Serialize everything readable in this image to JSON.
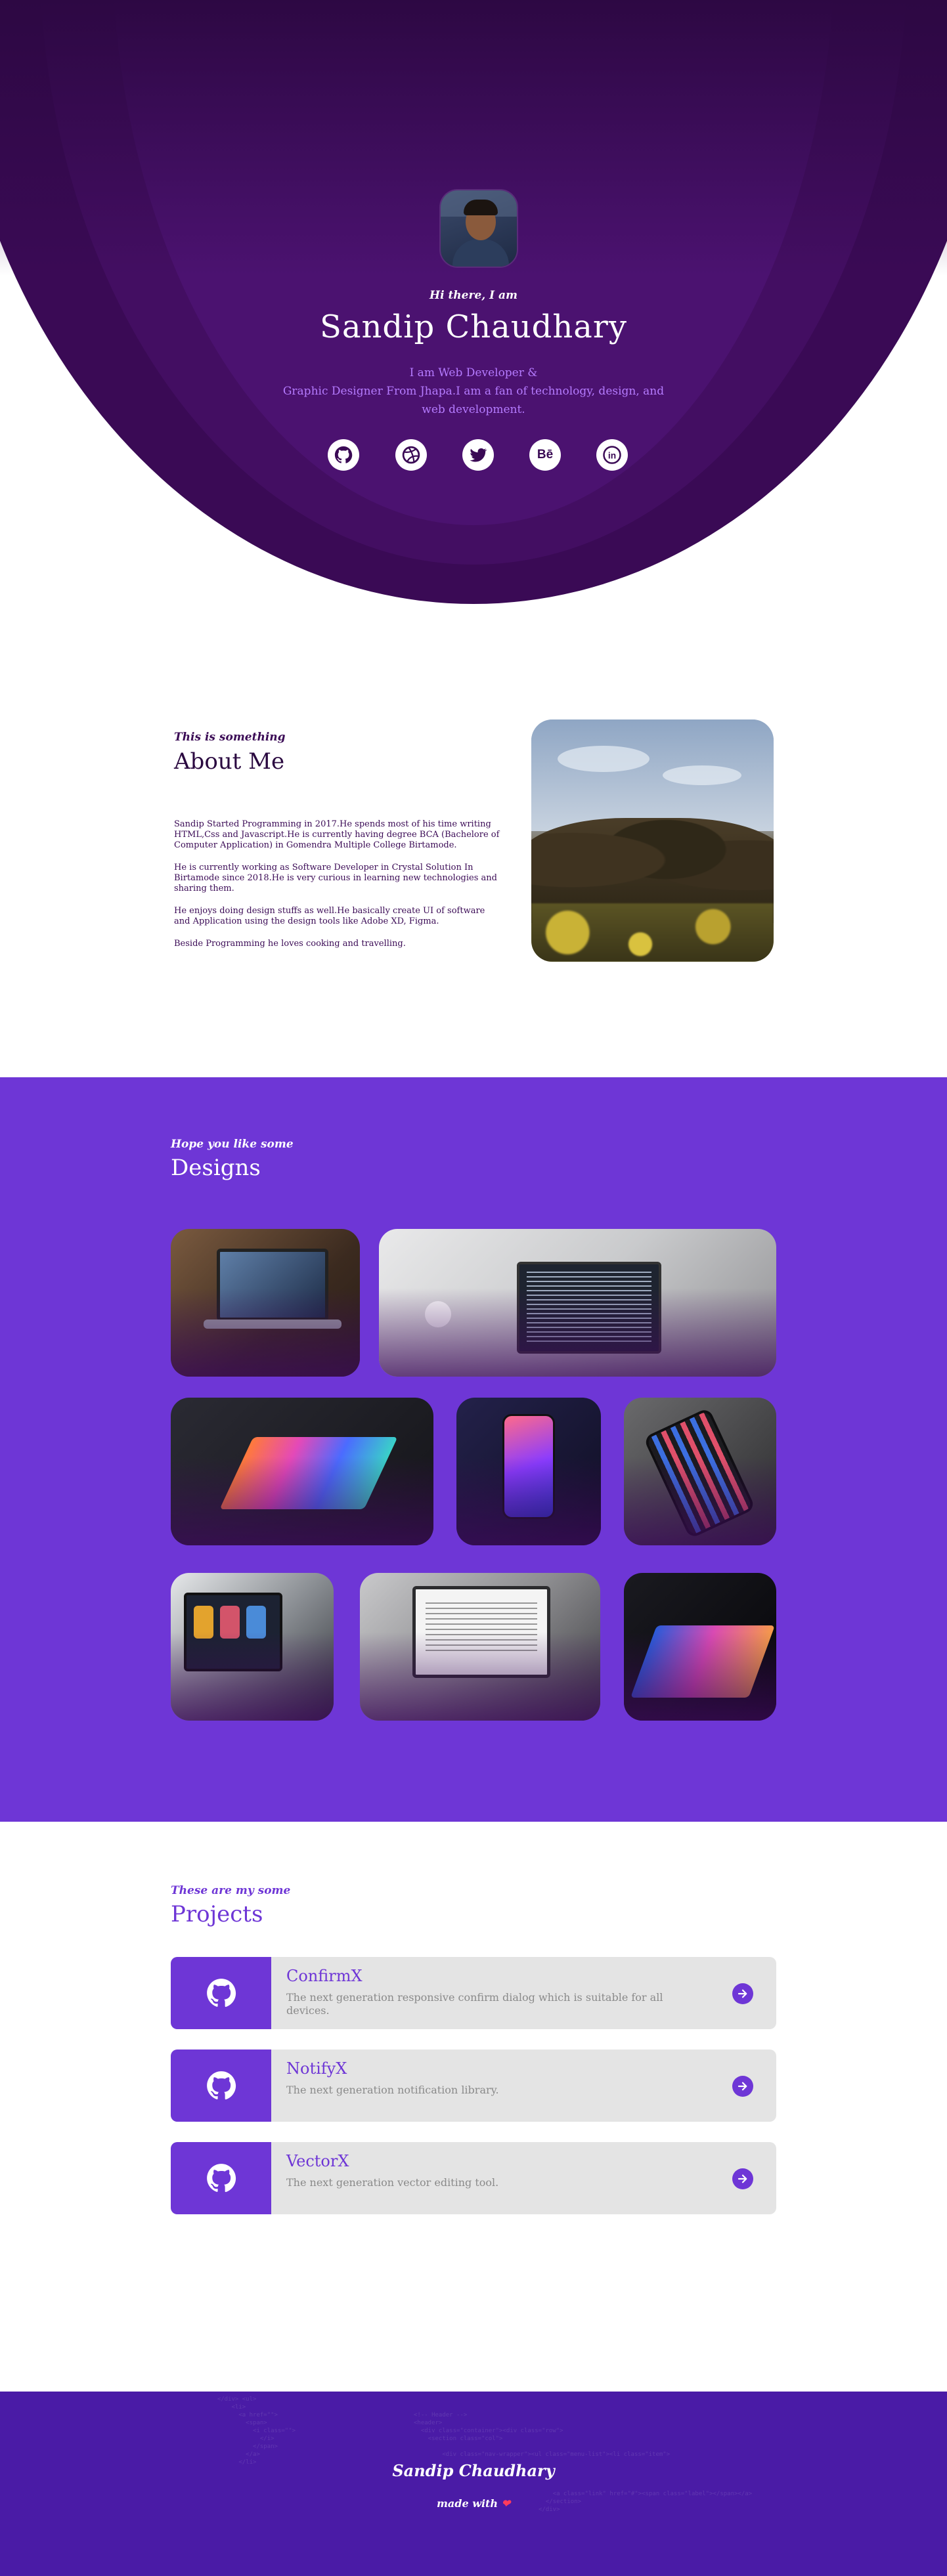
{
  "hero": {
    "greeting": "Hi there, I am",
    "name": "Sandip Chaudhary",
    "intro_line1": "I am Web Developer &",
    "intro_line2": "Graphic Designer From Jhapa.I am a fan of technology, design, and web development.",
    "socials": [
      {
        "name": "github",
        "icon": "github-icon"
      },
      {
        "name": "dribbble",
        "icon": "dribbble-icon"
      },
      {
        "name": "twitter",
        "icon": "twitter-icon"
      },
      {
        "name": "behance",
        "icon": "behance-icon",
        "glyph": "Bē"
      },
      {
        "name": "linkedin",
        "icon": "linkedin-icon",
        "glyph": "in"
      }
    ],
    "colors": {
      "bg_dark": "#360a50",
      "ring": "#4b1270",
      "accent_text": "#b57bff"
    }
  },
  "about": {
    "tag": "This is something",
    "title": "About Me",
    "paragraphs": [
      "Sandip Started Programming in 2017.He spends most of his time writing HTML,Css and Javascript.He is currently having degree BCA (Bachelore of Computer Application) in Gomendra Multiple College Birtamode.",
      "He is currently working as Software Developer in Crystal Solution In Birtamode since 2018.He is very curious in learning new technologies and sharing them.",
      "He enjoys doing design stuffs as well.He basically create UI of software and Application using the design tools like Adobe XD, Figma.",
      "Beside Programming he loves cooking and travelling."
    ]
  },
  "designs": {
    "tag": "Hope you like some",
    "title": "Designs",
    "accent": "#6e36d6"
  },
  "projects": {
    "tag": "These are my some",
    "title": "Projects",
    "items": [
      {
        "title": "ConfirmX",
        "description": "The next generation responsive confirm dialog which is suitable for all devices."
      },
      {
        "title": "NotifyX",
        "description": "The next generation notification library."
      },
      {
        "title": "VectorX",
        "description": "The next generation vector editing tool."
      }
    ]
  },
  "footer": {
    "name": "Sandip Chaudhary",
    "made_with": "made with",
    "heart": "❤",
    "bg": "#4a1ba6"
  }
}
